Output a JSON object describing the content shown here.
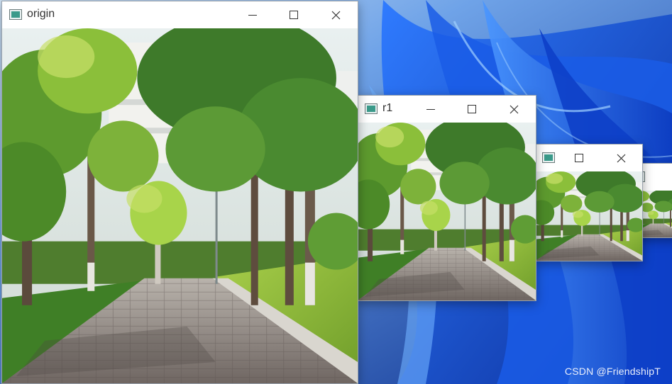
{
  "windows": {
    "origin": {
      "title": "origin"
    },
    "r1": {
      "title": "r1"
    },
    "r2": {
      "title": ""
    },
    "r3": {
      "title": ""
    }
  },
  "controls": {
    "minimize": "minimize-icon",
    "maximize": "maximize-icon",
    "close": "close-icon"
  },
  "watermark": "CSDN @FriendshipT",
  "colors": {
    "wallpaper": "#1456d6",
    "titlebar": "#ffffff",
    "grass": "#8fbf3a",
    "path": "#8d8683"
  }
}
